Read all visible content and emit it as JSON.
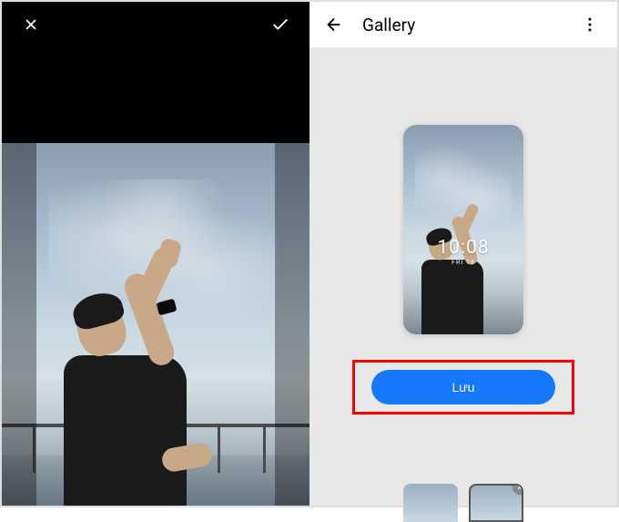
{
  "editor": {
    "close_label": "Close",
    "confirm_label": "Confirm"
  },
  "gallery": {
    "title": "Gallery",
    "back_label": "Back",
    "more_label": "More options",
    "preview": {
      "time": "10:08",
      "date": "FRI 18"
    },
    "save_button_label": "Lưu",
    "thumbnails": {
      "remove_label": "Remove"
    }
  },
  "colors": {
    "accent": "#1677ff",
    "highlight_border": "#ff0000"
  }
}
